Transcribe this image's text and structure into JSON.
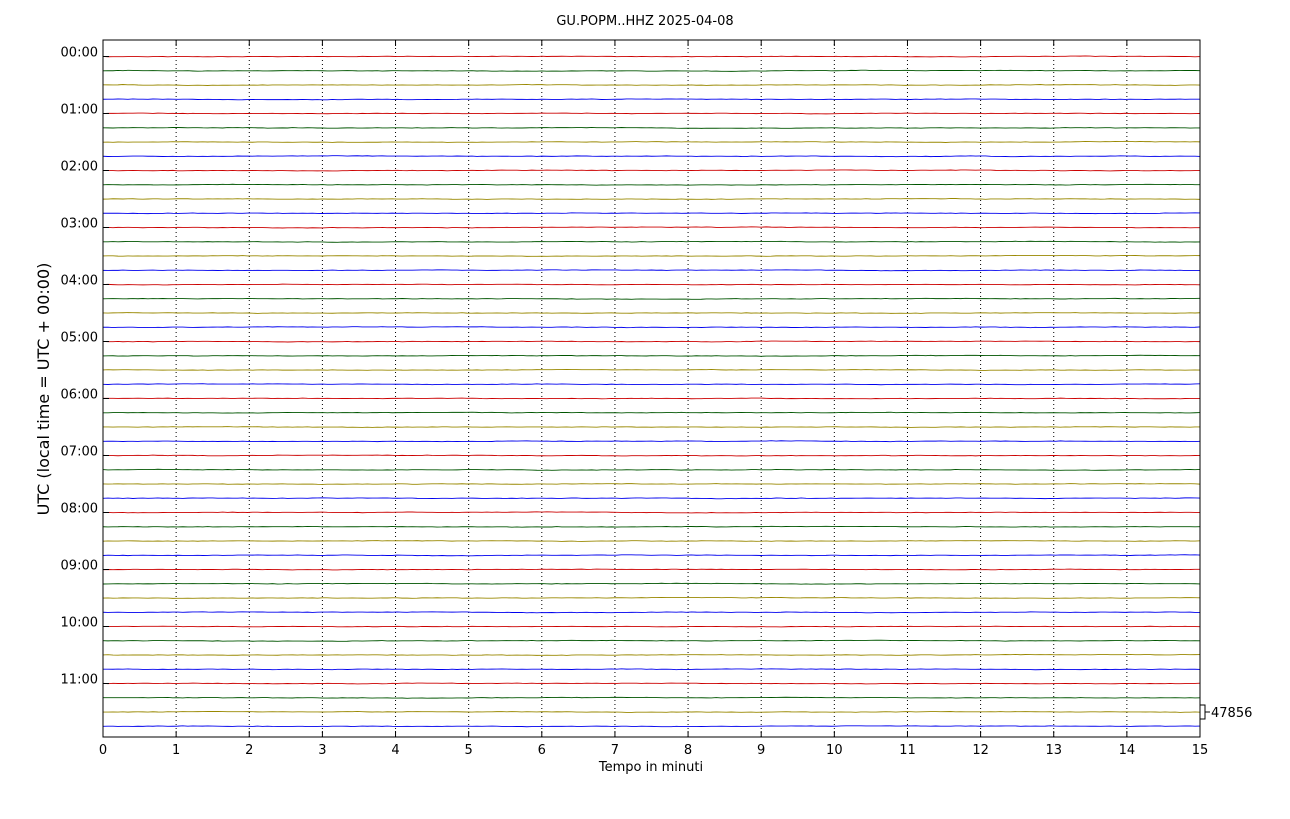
{
  "chart_data": {
    "type": "line",
    "title": "GU.POPM..HHZ 2025-04-08",
    "xlabel": "Tempo in minuti",
    "ylabel": "UTC (local time = UTC + 00:00)",
    "xlim": [
      0,
      15
    ],
    "x_ticks": [
      "0",
      "1",
      "2",
      "3",
      "4",
      "5",
      "6",
      "7",
      "8",
      "9",
      "10",
      "11",
      "12",
      "13",
      "14",
      "15"
    ],
    "y_tick_labels": [
      "00:00",
      "01:00",
      "02:00",
      "03:00",
      "04:00",
      "05:00",
      "06:00",
      "07:00",
      "08:00",
      "09:00",
      "10:00",
      "11:00"
    ],
    "rows": 48,
    "row_minutes": 15,
    "trace_colors": [
      "#cc0000",
      "#005500",
      "#998800",
      "#0000ee"
    ],
    "grid": "vertical dotted at each minute",
    "scale_label": "47856"
  }
}
